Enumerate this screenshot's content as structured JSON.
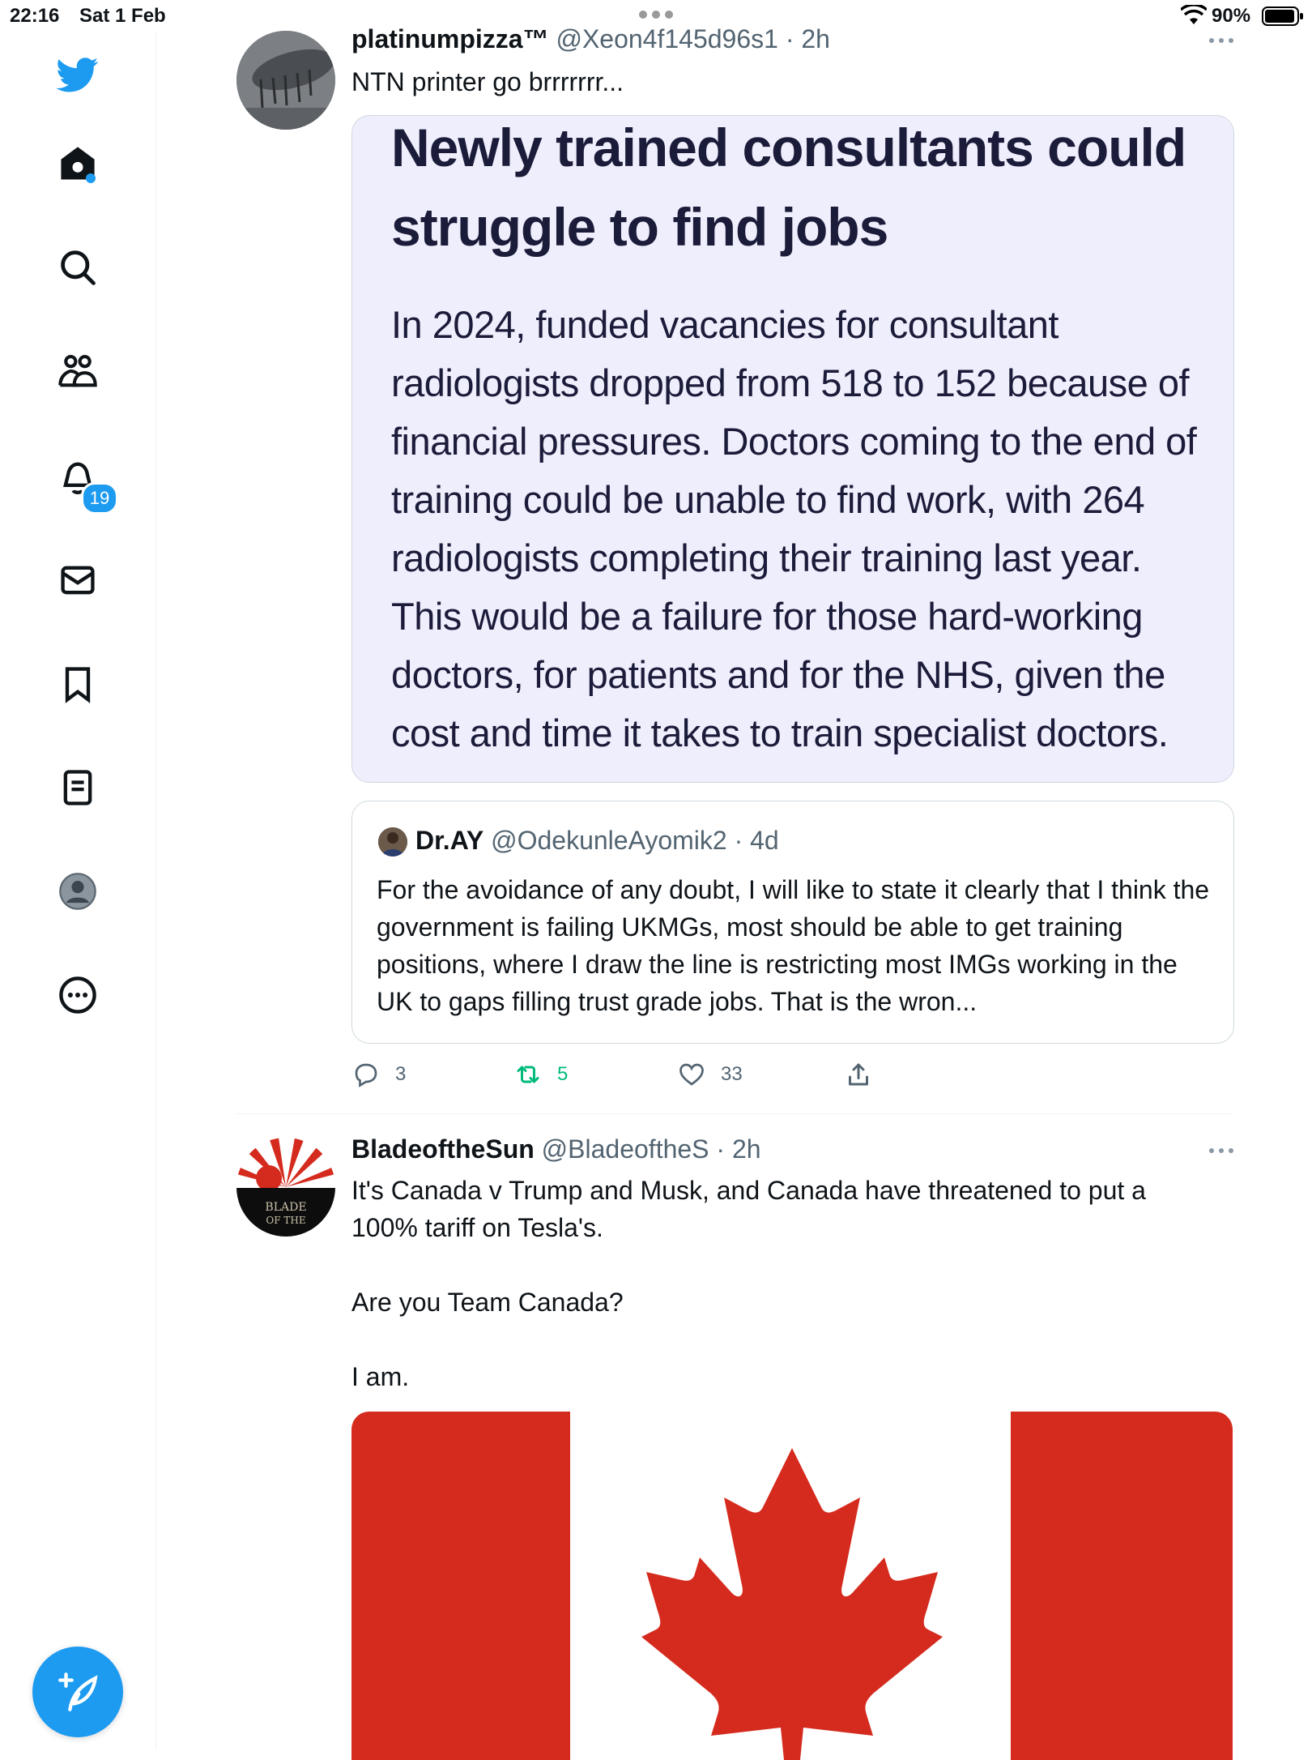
{
  "status_bar": {
    "time": "22:16",
    "date": "Sat 1 Feb",
    "battery": "90%"
  },
  "sidebar": {
    "notifications_badge": "19",
    "items": [
      "twitter-logo",
      "home-icon",
      "search-icon",
      "communities-icon",
      "notifications-icon",
      "messages-icon",
      "bookmarks-icon",
      "lists-icon",
      "profile-icon",
      "more-icon"
    ]
  },
  "tweet1": {
    "name": "platinumpizza™",
    "handle": "@Xeon4f145d96s1",
    "time": "· 2h",
    "text": "NTN printer go brrrrrrr...",
    "article": {
      "headline": "Newly trained consultants could struggle to find jobs",
      "body": "In 2024, funded vacancies for consultant radiologists dropped from 518 to 152 because of financial pressures. Doctors coming to the end of training could be unable to find work, with 264 radiologists completing their training last year. This would be a failure for those hard-working doctors, for patients and for the NHS, given the cost and time it takes to train specialist doctors."
    },
    "quote": {
      "name": "Dr.AY",
      "handle": "@OdekunleAyomik2",
      "time": "· 4d",
      "text": "For the avoidance of any doubt, I will like to state it clearly that I think the government is failing UKMGs, most should be able to get training positions, where I draw the line is restricting most IMGs working in the UK to gaps filling trust grade jobs. That is the wron..."
    },
    "actions": {
      "replies": "3",
      "retweets": "5",
      "likes": "33"
    }
  },
  "tweet2": {
    "name": "BladeoftheSun",
    "handle": "@BladeoftheS",
    "time": "· 2h",
    "text_lines": [
      "It's Canada v Trump and Musk, and Canada have threatened to put a",
      "100% tariff on Tesla's.",
      "",
      "Are you Team Canada?",
      "",
      "I am."
    ],
    "avatar_text": "BLADE OF THE"
  },
  "colors": {
    "accent": "#1d9bf0",
    "retweet_green": "#00ba7c",
    "flag_red": "#d52b1e"
  }
}
